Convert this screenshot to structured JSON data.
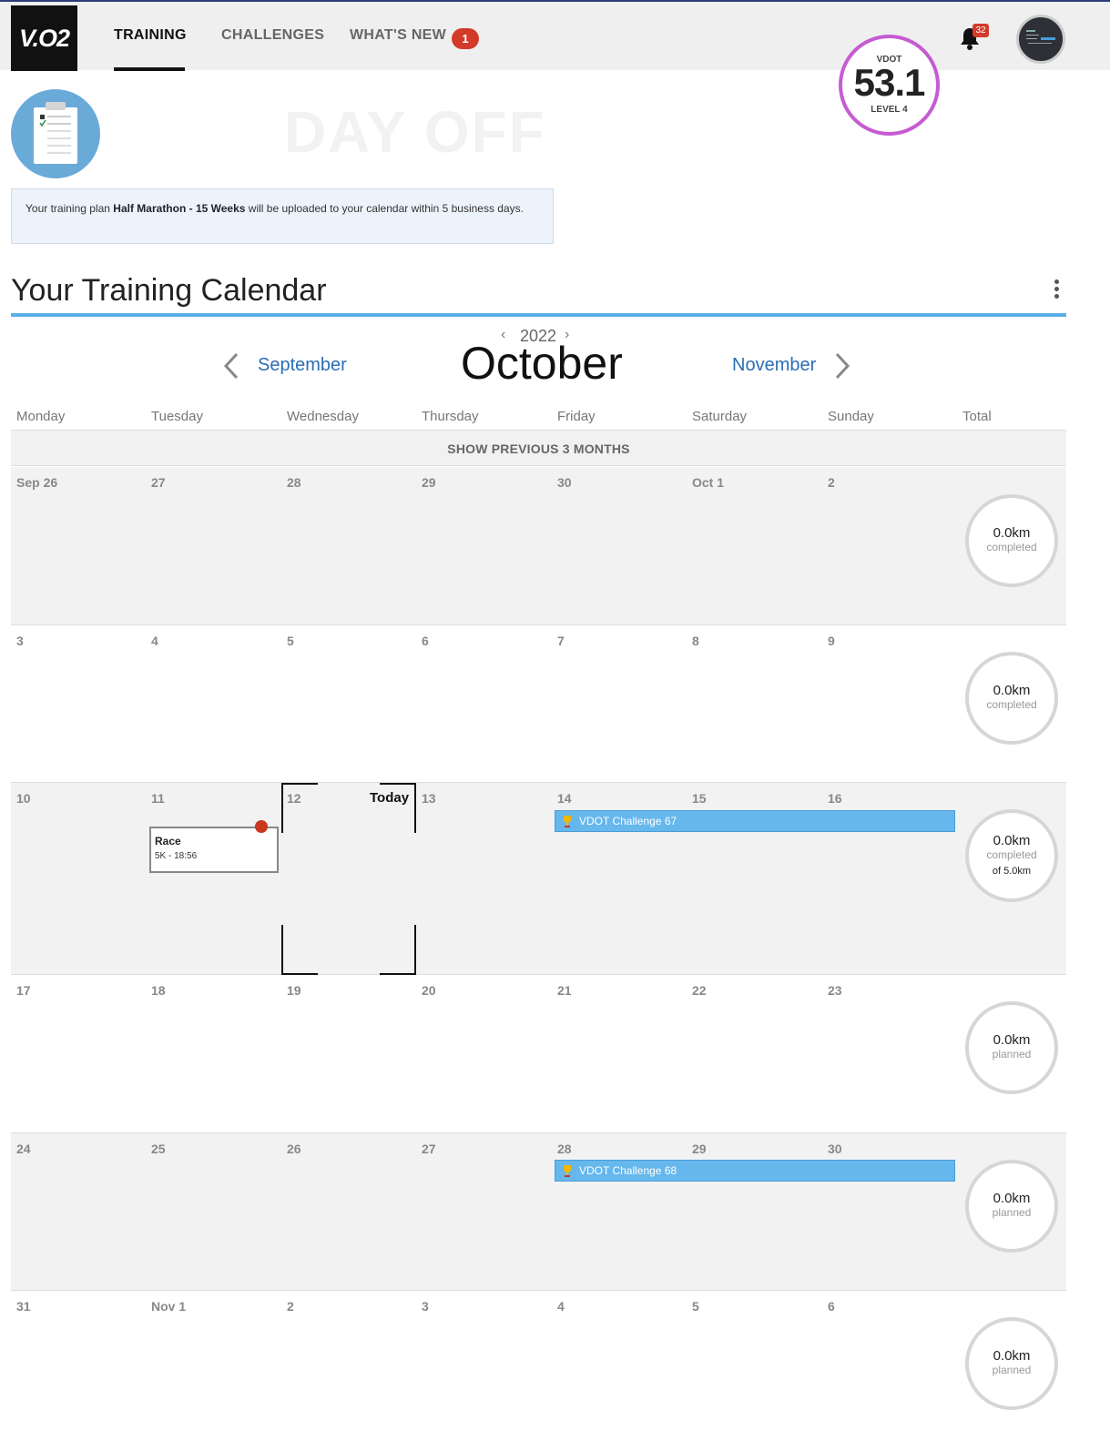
{
  "nav": {
    "logo": "V.O2",
    "tabs": [
      {
        "label": "TRAINING",
        "active": true
      },
      {
        "label": "CHALLENGES",
        "active": false
      },
      {
        "label": "WHAT'S NEW",
        "active": false
      }
    ],
    "whats_new_badge": "1",
    "notifications_count": "32"
  },
  "vdot": {
    "label": "VDOT",
    "value": "53.1",
    "level": "LEVEL 4",
    "ring_color": "#c65bd2"
  },
  "hero": {
    "watermark": "DAY OFF"
  },
  "notice": {
    "prefix": "Your training plan ",
    "plan": "Half Marathon - 15 Weeks",
    "suffix": " will be uploaded to your calendar within 5 business days."
  },
  "calendar": {
    "title": "Your Training Calendar",
    "year": "2022",
    "month": "October",
    "prev_month": "September",
    "next_month": "November",
    "days_of_week": [
      "Monday",
      "Tuesday",
      "Wednesday",
      "Thursday",
      "Friday",
      "Saturday",
      "Sunday",
      "Total"
    ],
    "show_previous": "SHOW PREVIOUS 3 MONTHS",
    "today_label": "Today",
    "weeks": [
      {
        "days": [
          "Sep 26",
          "27",
          "28",
          "29",
          "30",
          "Oct 1",
          "2"
        ],
        "total_km": "0.0km",
        "total_sub": "completed",
        "total_of": ""
      },
      {
        "days": [
          "3",
          "4",
          "5",
          "6",
          "7",
          "8",
          "9"
        ],
        "total_km": "0.0km",
        "total_sub": "completed",
        "total_of": ""
      },
      {
        "days": [
          "10",
          "11",
          "12",
          "13",
          "14",
          "15",
          "16"
        ],
        "total_km": "0.0km",
        "total_sub": "completed",
        "total_of": "of 5.0km",
        "race": {
          "title": "Race",
          "detail": "5K - 18:56"
        },
        "event": "VDOT Challenge 67"
      },
      {
        "days": [
          "17",
          "18",
          "19",
          "20",
          "21",
          "22",
          "23"
        ],
        "total_km": "0.0km",
        "total_sub": "planned",
        "total_of": ""
      },
      {
        "days": [
          "24",
          "25",
          "26",
          "27",
          "28",
          "29",
          "30"
        ],
        "total_km": "0.0km",
        "total_sub": "planned",
        "total_of": "",
        "event": "VDOT Challenge 68"
      },
      {
        "days": [
          "31",
          "Nov 1",
          "2",
          "3",
          "4",
          "5",
          "6"
        ],
        "total_km": "0.0km",
        "total_sub": "planned",
        "total_of": ""
      }
    ]
  },
  "colors": {
    "accent": "#5aaee8",
    "event": "#66b7ec",
    "badge": "#d23a2a",
    "race_dot": "#c9391f"
  }
}
